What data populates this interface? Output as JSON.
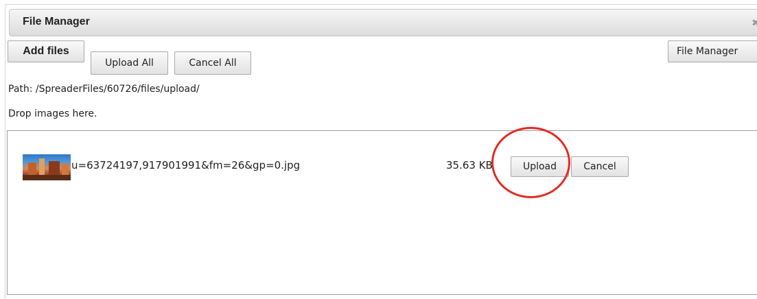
{
  "dialog": {
    "title": "File Manager",
    "close_icon": "close-icon"
  },
  "toolbar": {
    "add_files_label": "Add files",
    "upload_all_label": "Upload All",
    "cancel_all_label": "Cancel All",
    "file_manager_label": "File Manager"
  },
  "path_text": "Path: /SpreaderFiles/60726/files/upload/",
  "drop_hint": "Drop images here.",
  "files": [
    {
      "thumbnail": "image-thumbnail",
      "name": "u=63724197,917901991&fm=26&gp=0.jpg",
      "size": "35.63 KB",
      "upload_label": "Upload",
      "cancel_label": "Cancel"
    }
  ],
  "colors": {
    "highlight_ring": "#e42a22",
    "titlebar": "#e4e4e4"
  }
}
